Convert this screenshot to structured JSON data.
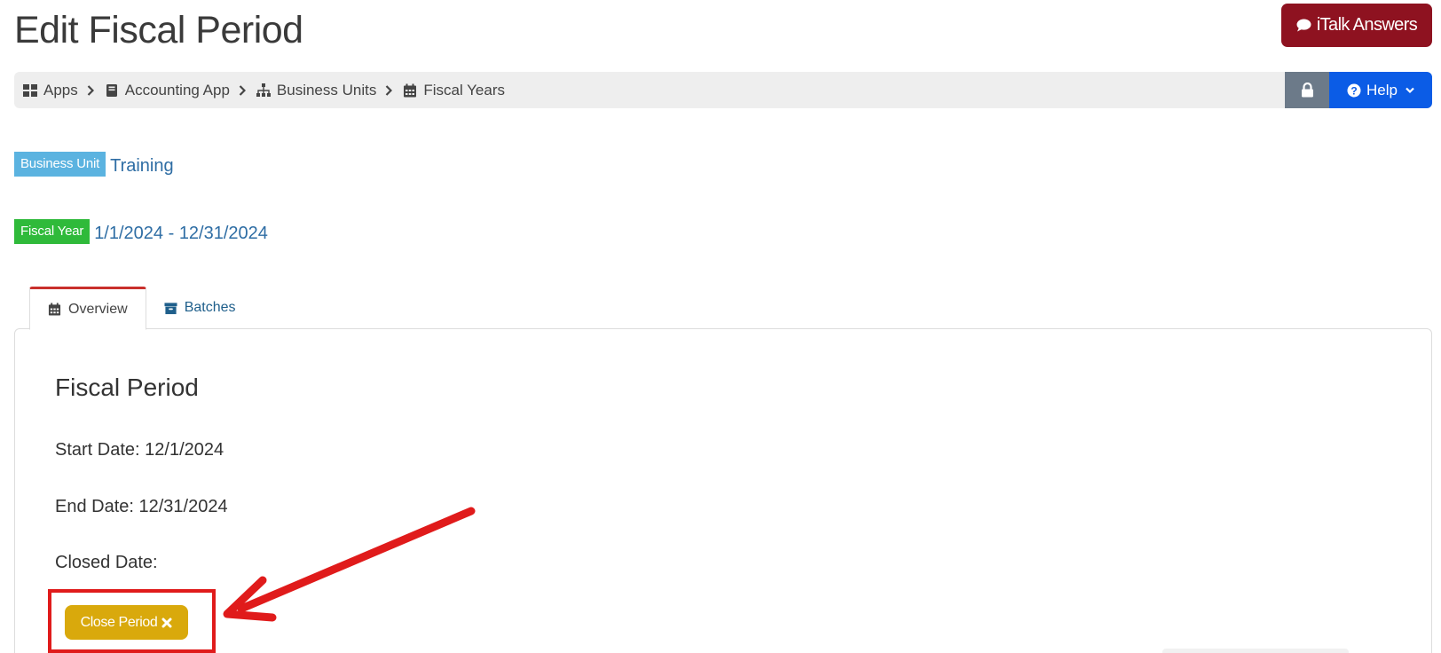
{
  "header": {
    "title": "Edit Fiscal Period",
    "italk_label": "iTalk Answers"
  },
  "breadcrumb": [
    {
      "label": "Apps",
      "icon": "th-large-icon"
    },
    {
      "label": "Accounting App",
      "icon": "book-icon"
    },
    {
      "label": "Business Units",
      "icon": "sitemap-icon"
    },
    {
      "label": "Fiscal Years",
      "icon": "calendar-icon"
    }
  ],
  "toolbar": {
    "help_label": "Help"
  },
  "business_unit": {
    "badge": "Business Unit",
    "value": "Training"
  },
  "fiscal_year": {
    "badge": "Fiscal Year",
    "value": "1/1/2024 - 12/31/2024"
  },
  "tabs": [
    {
      "label": "Overview",
      "icon": "calendar-icon",
      "active": true
    },
    {
      "label": "Batches",
      "icon": "archive-icon",
      "active": false
    }
  ],
  "fiscal_period": {
    "heading": "Fiscal Period",
    "start_date": "Start Date: 12/1/2024",
    "end_date": "End Date: 12/31/2024",
    "closed_date": "Closed Date:",
    "close_button": "Close Period"
  },
  "colors": {
    "italk_bg": "#8e1220",
    "help_bg": "#0b5ce6",
    "lock_bg": "#6c7a89",
    "badge_blue": "#5bb3e0",
    "badge_green": "#2fba3a",
    "close_button_bg": "#d9a90c",
    "annotation_red": "#e01b1b",
    "active_tab_border": "#c9302c"
  }
}
